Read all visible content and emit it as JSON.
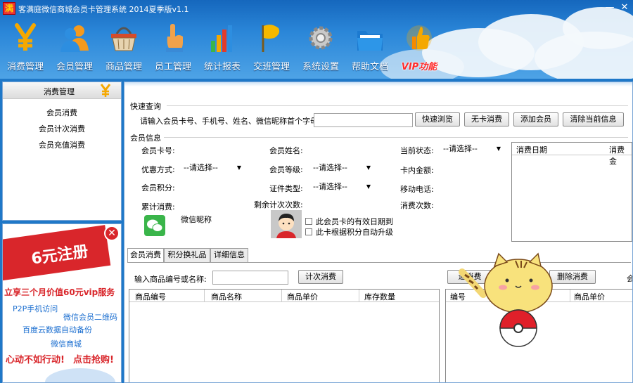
{
  "app": {
    "logo_char": "满",
    "title": "客满庭微信商城会员卡管理系统 2014夏季版v1.1"
  },
  "window_controls": {
    "minimize": "—",
    "close": "✕"
  },
  "nav": [
    {
      "label": "消费管理",
      "icon": "yen-icon"
    },
    {
      "label": "会员管理",
      "icon": "member-icon"
    },
    {
      "label": "商品管理",
      "icon": "basket-icon"
    },
    {
      "label": "员工管理",
      "icon": "hand-pointer-icon"
    },
    {
      "label": "统计报表",
      "icon": "bar-chart-icon"
    },
    {
      "label": "交班管理",
      "icon": "flag-icon"
    },
    {
      "label": "系统设置",
      "icon": "gear-icon"
    },
    {
      "label": "帮助文档",
      "icon": "folder-icon"
    },
    {
      "label": "VIP功能",
      "icon": "thumbs-up-icon"
    }
  ],
  "sidebar": {
    "title": "消费管理",
    "items": [
      {
        "label": "会员消费"
      },
      {
        "label": "会员计次消费"
      },
      {
        "label": "会员充值消费"
      }
    ]
  },
  "ad": {
    "headline": "6元注册",
    "line1": "立享三个月价值60元vip服务",
    "line2": "P2P手机访问",
    "line3": "微信会员二维码",
    "line4": "百度云数据自动备份",
    "line5": "微信商城",
    "line6": "心动不如行动!",
    "cta": "点击抢购!"
  },
  "quick_query": {
    "group_title": "快速查询",
    "prompt": "请输入会员卡号、手机号、姓名、微信昵称首个字母",
    "input_value": "",
    "buttons": {
      "browse": "快速浏览",
      "no_card": "无卡消费",
      "add_member": "添加会员",
      "clear": "清除当前信息"
    }
  },
  "member_info": {
    "group_title": "会员信息",
    "labels": {
      "card_no": "会员卡号:",
      "name": "会员姓名:",
      "status": "当前状态:",
      "discount": "优惠方式:",
      "level": "会员等级:",
      "balance": "卡内金额:",
      "points": "会员积分:",
      "id_type": "证件类型:",
      "mobile": "移动电话:",
      "total_spend": "累计消费:",
      "remaining_count": "剩余计次次数:",
      "visit_count": "消费次数:",
      "wechat_nick": "微信昵称"
    },
    "select_placeholder": "--请选择--",
    "checks": {
      "expiry": "此会员卡的有效日期到",
      "auto_upgrade": "此卡根据积分自动升级"
    },
    "history_table": {
      "col1": "消费日期",
      "col2": "消费金"
    }
  },
  "tabs": [
    {
      "label": "会员消费",
      "active": true
    },
    {
      "label": "积分换礼品",
      "active": false
    },
    {
      "label": "详细信息",
      "active": false
    }
  ],
  "consume": {
    "input_label": "输入商品编号或名称:",
    "input_value": "",
    "count_button": "计次消费",
    "right_btn1": "追消费",
    "right_btn2": "删除消费",
    "right_edge": "会",
    "product_table": {
      "columns": [
        "商品编号",
        "商品名称",
        "商品单价",
        "库存数量"
      ]
    },
    "cart_table": {
      "columns": [
        "编号",
        "商品单价"
      ]
    }
  }
}
